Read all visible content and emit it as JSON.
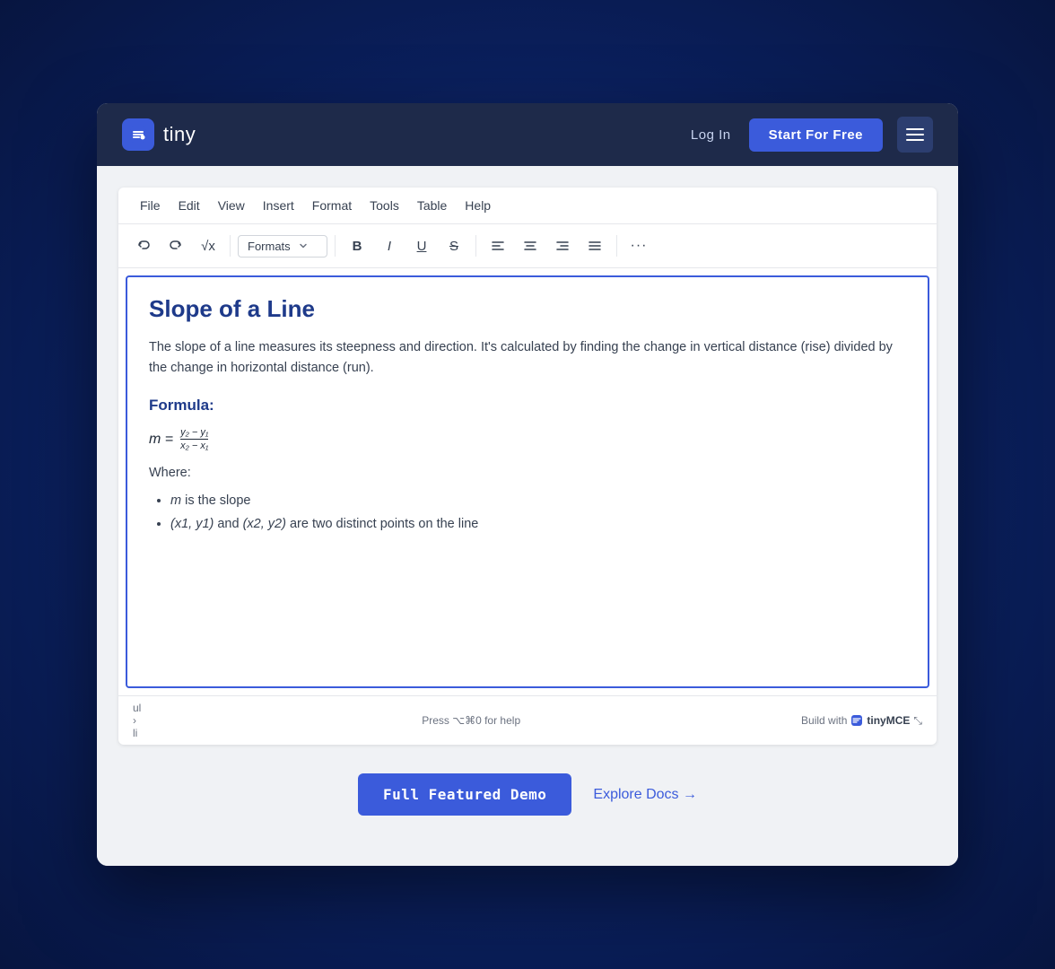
{
  "nav": {
    "logo_text": "tiny",
    "login_label": "Log In",
    "cta_label": "Start For Free"
  },
  "menu_bar": {
    "items": [
      "File",
      "Edit",
      "View",
      "Insert",
      "Format",
      "Tools",
      "Table",
      "Help"
    ]
  },
  "toolbar": {
    "formats_label": "Formats",
    "bold": "B",
    "italic": "I",
    "underline": "U",
    "strikethrough": "S",
    "more_label": "···"
  },
  "editor": {
    "title": "Slope of a Line",
    "paragraph": "The slope of a line measures its steepness and direction. It's calculated by finding the change in vertical distance (rise) divided by the change in horizontal distance (run).",
    "formula_heading": "Formula:",
    "formula_m": "m =",
    "formula_numerator": "y₂ − y₁",
    "formula_denominator": "x₂ − x₁",
    "where_label": "Where:",
    "bullet_1_italic": "m",
    "bullet_1_rest": " is the slope",
    "bullet_2_part1_italic": "(x1, y1)",
    "bullet_2_and": " and ",
    "bullet_2_part2_italic": "(x2, y2)",
    "bullet_2_rest": " are two distinct points on the line"
  },
  "status_bar": {
    "path": "ul › li",
    "help": "Press ⌥⌘0 for help",
    "brand": "Build with",
    "brand_name": "tinyMCE"
  },
  "actions": {
    "full_demo": "Full Featured Demo",
    "explore_docs": "Explore Docs →"
  }
}
